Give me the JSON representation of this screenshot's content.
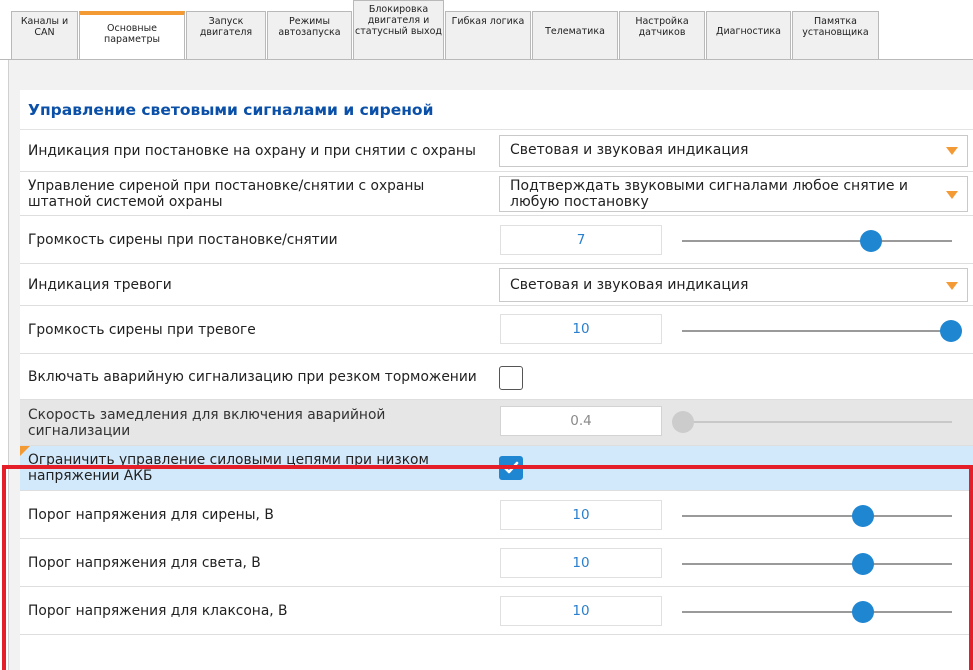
{
  "tabs": [
    {
      "label": "Каналы и CAN"
    },
    {
      "label": "Основные параметры"
    },
    {
      "label": "Запуск двигателя"
    },
    {
      "label": "Режимы автозапуска"
    },
    {
      "label": "Блокировка двигателя и статусный выход"
    },
    {
      "label": "Гибкая логика"
    },
    {
      "label": "Телематика"
    },
    {
      "label": "Настройка датчиков"
    },
    {
      "label": "Диагностика"
    },
    {
      "label": "Памятка установщика"
    }
  ],
  "active_tab": "Основные параметры",
  "section": {
    "title": "Управление световыми сигналами и сиреной"
  },
  "rows": {
    "arm_indication": {
      "label": "Индикация при постановке на охрану и при снятии с охраны",
      "value": "Световая и звуковая индикация"
    },
    "siren_control": {
      "label": "Управление сиреной при постановке/снятии с охраны штатной системой охраны",
      "value": "Подтверждать звуковыми сигналами любое снятие и любую постановку"
    },
    "siren_volume_arm": {
      "label": "Громкость сирены при постановке/снятии",
      "value": "7",
      "level": 0.7
    },
    "alarm_indication": {
      "label": "Индикация тревоги",
      "value": "Световая и звуковая индикация"
    },
    "siren_volume_alarm": {
      "label": "Громкость сирены при тревоге",
      "value": "10",
      "level": 1.0
    },
    "hazard_on_braking": {
      "label": "Включать аварийную сигнализацию при резком торможении",
      "checked": false
    },
    "deceleration_speed": {
      "label": "Скорость замедления для включения аварийной сигнализации",
      "value": "0.4",
      "level": 0.0,
      "disabled": true
    },
    "limit_low_voltage": {
      "label": "Ограничить управление силовыми цепями при низком напряжении АКБ",
      "checked": true
    },
    "threshold_siren": {
      "label": "Порог напряжения для сирены, В",
      "value": "10",
      "level": 0.67
    },
    "threshold_light": {
      "label": "Порог напряжения для света, В",
      "value": "10",
      "level": 0.67
    },
    "threshold_horn": {
      "label": "Порог напряжения для клаксона, В",
      "value": "10",
      "level": 0.67
    }
  },
  "colors": {
    "accent_orange": "#f39a35",
    "title_blue": "#0a4fa8",
    "slider_blue": "#1f86d2",
    "highlight_row": "#d2e9fb",
    "red_frame": "#e51f2a"
  }
}
